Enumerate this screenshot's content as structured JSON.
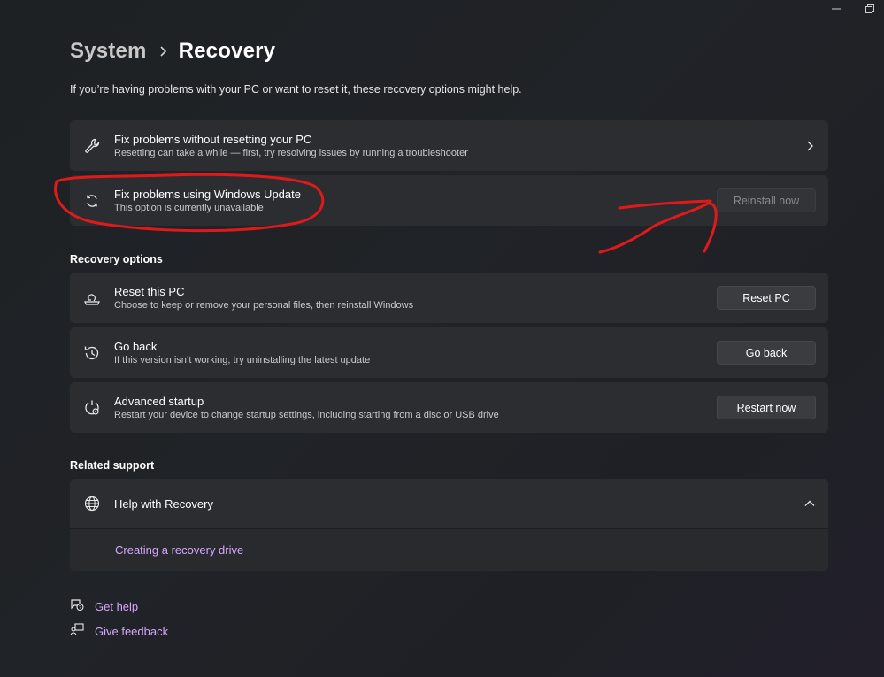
{
  "window": {
    "minimize_icon": "minimize-icon",
    "restore_icon": "restore-icon"
  },
  "breadcrumb": {
    "parent": "System",
    "current": "Recovery"
  },
  "intro": "If you’re having problems with your PC or want to reset it, these recovery options might help.",
  "top_cards": [
    {
      "title": "Fix problems without resetting your PC",
      "subtitle": "Resetting can take a while — first, try resolving issues by running a troubleshooter",
      "icon": "wrench-icon"
    },
    {
      "title": "Fix problems using Windows Update",
      "subtitle": "This option is currently unavailable",
      "icon": "sync-icon",
      "button": "Reinstall now"
    }
  ],
  "recovery_options": {
    "heading": "Recovery options",
    "items": [
      {
        "title": "Reset this PC",
        "subtitle": "Choose to keep or remove your personal files, then reinstall Windows",
        "button": "Reset PC",
        "icon": "reset-pc-icon"
      },
      {
        "title": "Go back",
        "subtitle": "If this version isn’t working, try uninstalling the latest update",
        "button": "Go back",
        "icon": "history-icon"
      },
      {
        "title": "Advanced startup",
        "subtitle": "Restart your device to change startup settings, including starting from a disc or USB drive",
        "button": "Restart now",
        "icon": "advanced-startup-icon"
      }
    ]
  },
  "related_support": {
    "heading": "Related support",
    "expander_title": "Help with Recovery",
    "link": "Creating a recovery drive"
  },
  "footer": {
    "get_help": "Get help",
    "give_feedback": "Give feedback"
  },
  "colors": {
    "link": "#d7a6ff",
    "annotation": "#e0191b",
    "card": "#2b2d30"
  }
}
